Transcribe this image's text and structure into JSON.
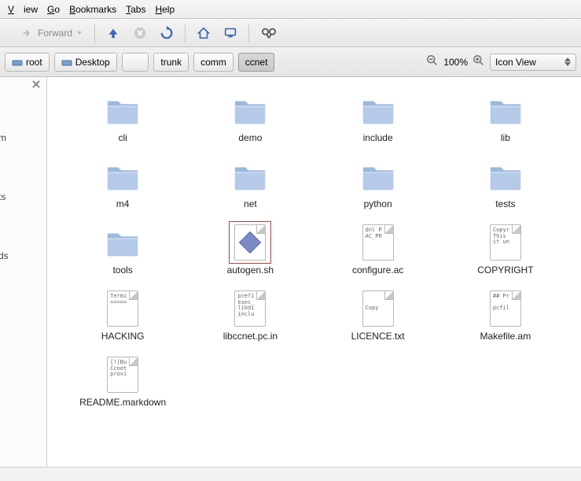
{
  "menu": {
    "view": "View",
    "go": "Go",
    "bookmarks": "Bookmarks",
    "tabs": "Tabs",
    "help": "Help"
  },
  "toolbar": {
    "forward": "Forward"
  },
  "path": {
    "crumbs": [
      {
        "label": "root",
        "icon": "drive"
      },
      {
        "label": "Desktop",
        "icon": "drive"
      },
      {
        "label": "",
        "icon": "none"
      },
      {
        "label": "trunk",
        "icon": "none"
      },
      {
        "label": "comm",
        "icon": "none"
      },
      {
        "label": "ccnet",
        "icon": "none",
        "active": true
      }
    ]
  },
  "zoom": {
    "level": "100%"
  },
  "viewmode": {
    "label": "Icon View"
  },
  "sidebar": {
    "t1": "m",
    "t2": "ts",
    "t3": "ds"
  },
  "items": [
    {
      "name": "cli",
      "type": "folder"
    },
    {
      "name": "demo",
      "type": "folder"
    },
    {
      "name": "include",
      "type": "folder"
    },
    {
      "name": "lib",
      "type": "folder"
    },
    {
      "name": "m4",
      "type": "folder"
    },
    {
      "name": "net",
      "type": "folder"
    },
    {
      "name": "python",
      "type": "folder"
    },
    {
      "name": "tests",
      "type": "folder"
    },
    {
      "name": "tools",
      "type": "folder"
    },
    {
      "name": "autogen.sh",
      "type": "script",
      "selected": true
    },
    {
      "name": "configure.ac",
      "type": "file",
      "preview": "dnl P\nAC_PR"
    },
    {
      "name": "COPYRIGHT",
      "type": "file",
      "preview": "Copyr\nThis\nit un"
    },
    {
      "name": "HACKING",
      "type": "file",
      "preview": "Termi\n====="
    },
    {
      "name": "libccnet.pc.in",
      "type": "file",
      "preview": "prefi\nexec_\nlibdi\ninclu"
    },
    {
      "name": "LICENCE.txt",
      "type": "file",
      "preview": "\n\nCopy"
    },
    {
      "name": "Makefile.am",
      "type": "file",
      "preview": "## Pr\n\npcfil"
    },
    {
      "name": "README.markdown",
      "type": "file",
      "preview": "[![Bu\nCcnet\nprovi"
    }
  ]
}
